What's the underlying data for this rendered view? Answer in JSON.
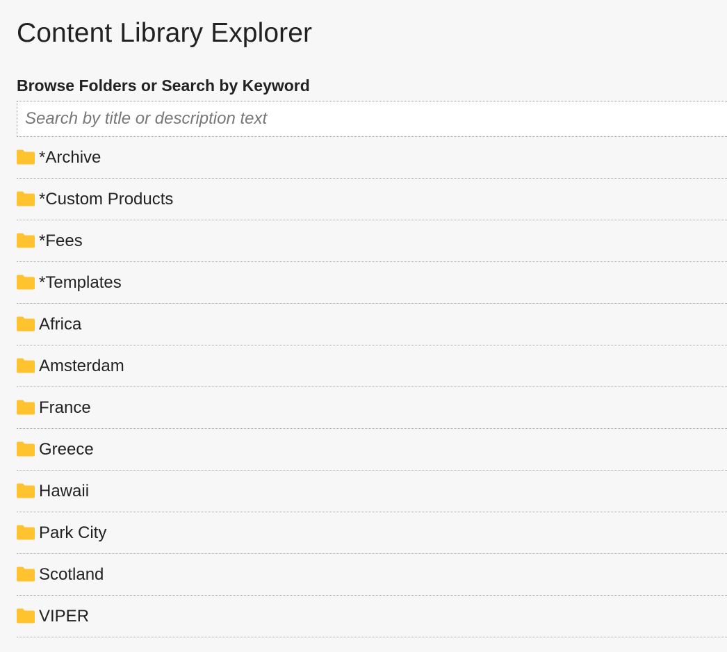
{
  "page": {
    "title": "Content Library Explorer"
  },
  "browse": {
    "label": "Browse Folders or Search by Keyword"
  },
  "search": {
    "placeholder": "Search by title or description text",
    "value": ""
  },
  "colors": {
    "folder_icon": "#fec32f",
    "background": "#f7f7f7"
  },
  "folders": [
    {
      "label": "*Archive",
      "icon": "folder-icon"
    },
    {
      "label": "*Custom Products",
      "icon": "folder-icon"
    },
    {
      "label": "*Fees",
      "icon": "folder-icon"
    },
    {
      "label": "*Templates",
      "icon": "folder-icon"
    },
    {
      "label": "Africa",
      "icon": "folder-icon"
    },
    {
      "label": "Amsterdam",
      "icon": "folder-icon"
    },
    {
      "label": "France",
      "icon": "folder-icon"
    },
    {
      "label": "Greece",
      "icon": "folder-icon"
    },
    {
      "label": "Hawaii",
      "icon": "folder-icon"
    },
    {
      "label": "Park City",
      "icon": "folder-icon"
    },
    {
      "label": "Scotland",
      "icon": "folder-icon"
    },
    {
      "label": "VIPER",
      "icon": "folder-icon"
    }
  ]
}
